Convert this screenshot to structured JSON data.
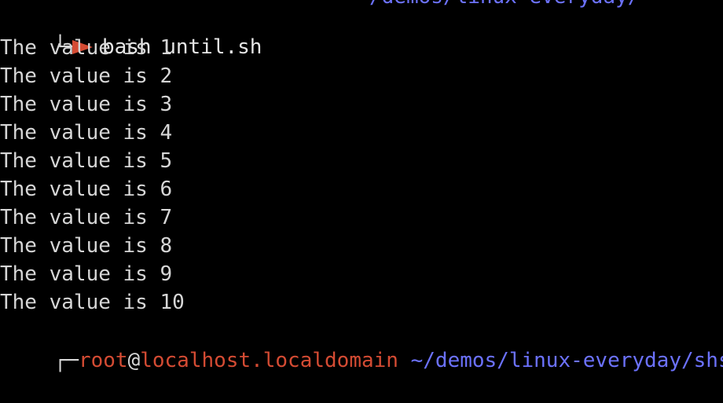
{
  "terminal": {
    "top_partial_path": "/demos/linux-everyday/",
    "previous_prompt": {
      "tree_glyph": "└─",
      "command": "bash until.sh"
    },
    "output_lines": [
      "The value is 1",
      "The value is 2",
      "The value is 3",
      "The value is 4",
      "The value is 5",
      "The value is 6",
      "The value is 7",
      "The value is 8",
      "The value is 9",
      "The value is 10"
    ],
    "current_prompt": {
      "tree_glyph": "┌─",
      "user": "root",
      "at": "@",
      "host": "localhost.localdomain",
      "cwd": "~/demos/linux-everyday/shs"
    }
  },
  "colors": {
    "background": "#000000",
    "text": "#d6d6d6",
    "user_host": "#d44b33",
    "path": "#6c72ff",
    "arrow": "#d44b33"
  },
  "icons": {
    "prompt_arrow": "arrow-icon"
  }
}
